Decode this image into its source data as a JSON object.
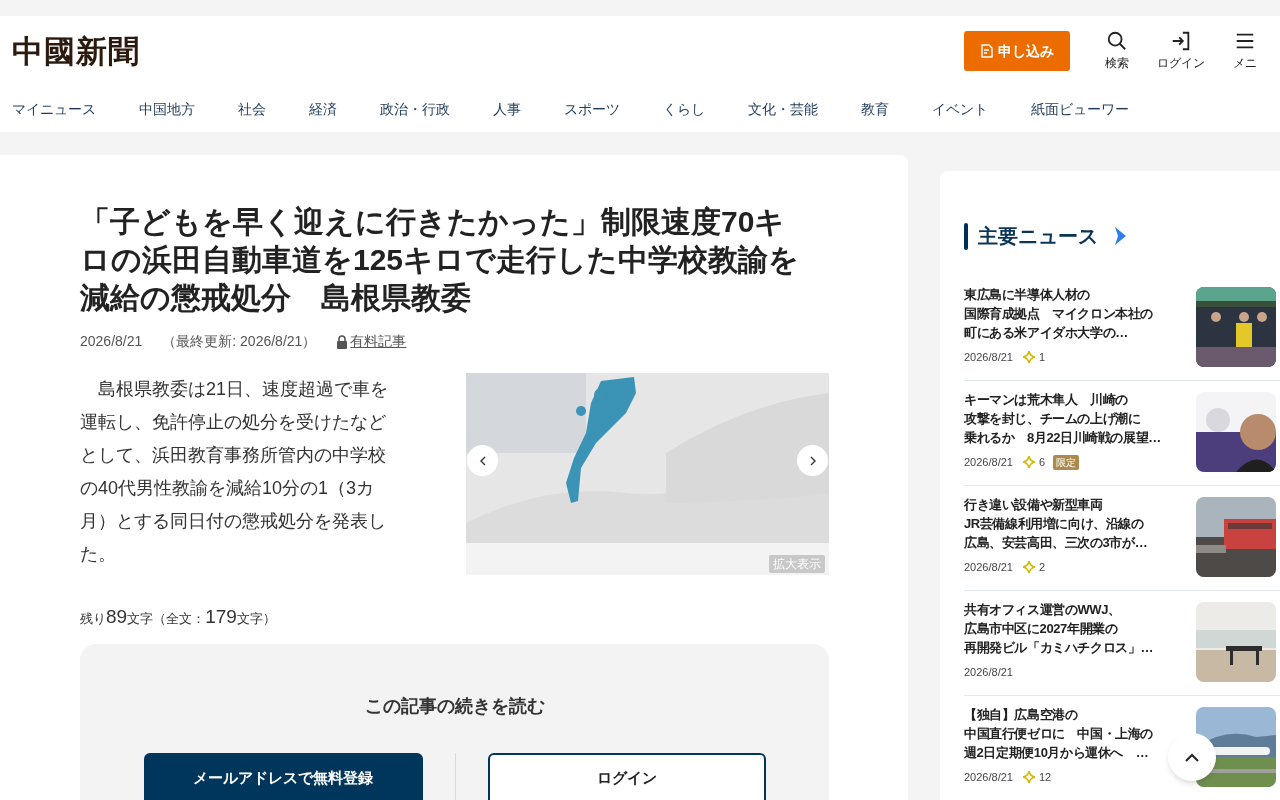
{
  "header": {
    "logo": "中國新聞",
    "subscribe_button": "申し込み",
    "tools": [
      {
        "kind": "search",
        "label": "検索"
      },
      {
        "kind": "login",
        "label": "ログイン"
      },
      {
        "kind": "menu",
        "label": "メニ"
      }
    ]
  },
  "nav": [
    "マイニュース",
    "中国地方",
    "社会",
    "経済",
    "政治・行政",
    "人事",
    "スポーツ",
    "くらし",
    "文化・芸能",
    "教育",
    "イベント",
    "紙面ビューワー"
  ],
  "article": {
    "headline": "「子どもを早く迎えに行きたかった」制限速度70キロの浜田自動車道を125キロで走行した中学校教諭を減給の懲戒処分　島根県教委",
    "date": "2026/8/21",
    "updated": "（最終更新: 2026/8/21）",
    "paid_link": "有料記事",
    "body": "　島根県教委は21日、速度超過で車を運転し、免許停止の処分を受けたなどとして、浜田教育事務所管内の中学校の40代男性教諭を減給10分の1（3カ月）とする同日付の懲戒処分を発表した。",
    "image": {
      "kind": "picture",
      "enlarge": "拡大表示"
    },
    "remaining": {
      "prefix": "残り",
      "remaining_count": "89",
      "middle": "文字（全文：",
      "total_count": "179",
      "suffix": "文字）"
    },
    "paywall": {
      "title": "この記事の続きを読む",
      "register_button": "メールアドレスで無料登録",
      "login_button": "ログイン"
    }
  },
  "sidebar": {
    "title": "主要ニュース",
    "items": [
      {
        "title_lines": [
          "東広島に半導体人材の",
          "国際育成拠点　マイクロン本社の",
          "町にある米アイダホ大学の…"
        ],
        "date": "2026/8/21",
        "count": "1"
      },
      {
        "title_lines": [
          "キーマンは荒木隼人　川崎の",
          "攻撃を封じ、チームの上げ潮に",
          "乗れるか　8月22日川崎戦の展望…"
        ],
        "date": "2026/8/21",
        "count": "6",
        "badge": "限定"
      },
      {
        "title_lines": [
          "行き違い設備や新型車両",
          "JR芸備線利用増に向け、沿線の",
          "広島、安芸高田、三次の3市が…"
        ],
        "date": "2026/8/21",
        "count": "2"
      },
      {
        "title_lines": [
          "共有オフィス運営のWWJ、",
          "広島市中区に2027年開業の",
          "再開発ビル「カミハチクロス」…"
        ],
        "date": "2026/8/21"
      },
      {
        "title_lines": [
          "【独自】広島空港の",
          "中国直行便ゼロに　中国・上海の",
          "週2日定期便10月から運休へ　…"
        ],
        "date": "2026/8/21",
        "count": "12"
      }
    ]
  }
}
